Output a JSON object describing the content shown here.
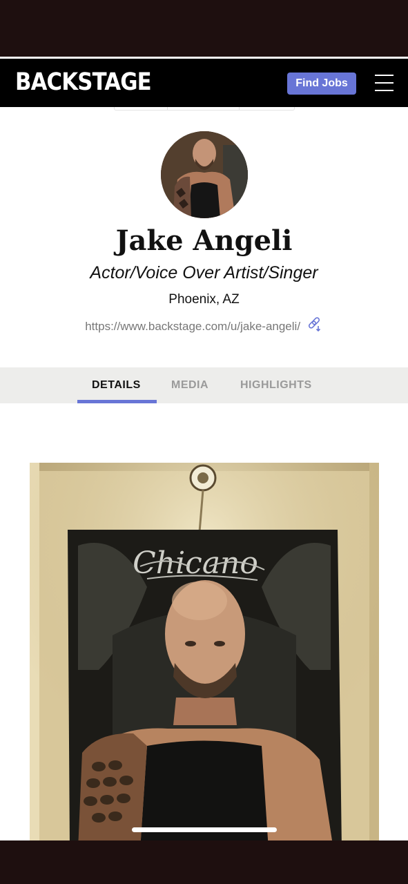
{
  "header": {
    "logo": "BACKSTAGE",
    "find_jobs_label": "Find Jobs",
    "menu_icon": "hamburger-menu-icon"
  },
  "profile": {
    "name": "Jake Angeli",
    "headline": "Actor/Voice Over Artist/Singer",
    "location": "Phoenix, AZ",
    "url": "https://www.backstage.com/u/jake-angeli/",
    "link_icon": "copy-link-icon"
  },
  "tabs": [
    {
      "label": "DETAILS",
      "active": true
    },
    {
      "label": "MEDIA",
      "active": false
    },
    {
      "label": "HIGHLIGHTS",
      "active": false
    }
  ],
  "media": {
    "banner_text": "Chicano"
  },
  "colors": {
    "accent": "#6875d6",
    "header_bg": "#000000",
    "tabbar_bg": "#ededeb"
  }
}
